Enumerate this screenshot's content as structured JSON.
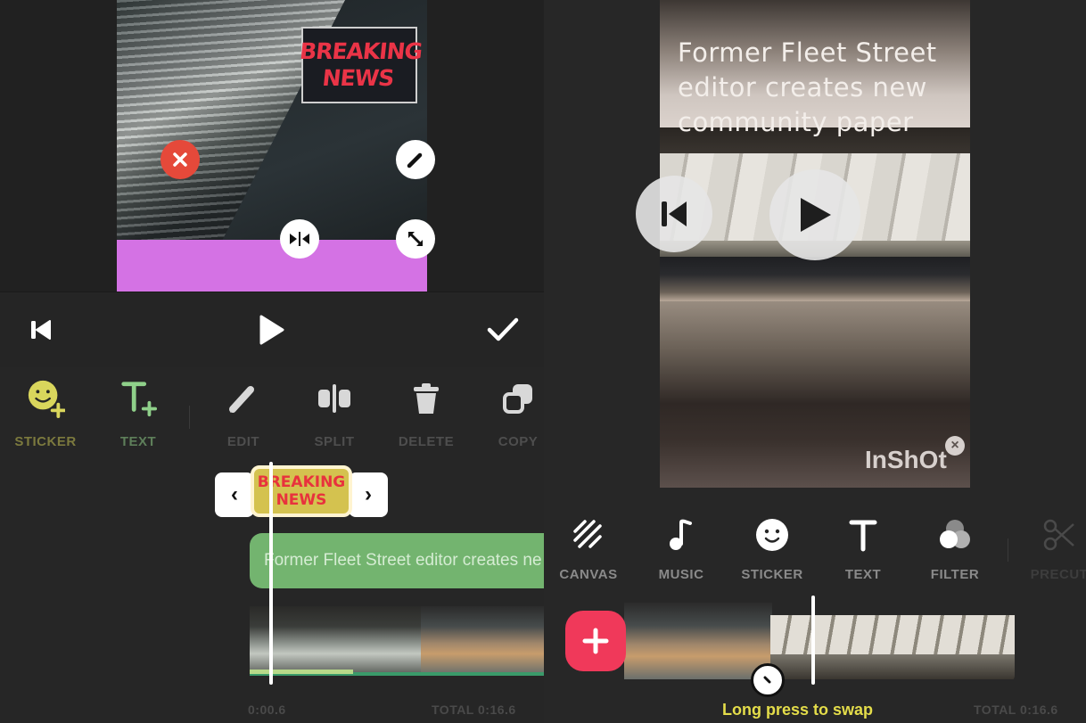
{
  "left_editor": {
    "sticker_overlay": {
      "line1": "BREAKING",
      "line2": "NEWS",
      "handles": [
        "delete-handle",
        "edit-handle",
        "flip-handle",
        "resize-handle"
      ]
    },
    "controls": {
      "rewind_icon": "skip-to-start-icon",
      "play_icon": "play-icon",
      "confirm_icon": "checkmark-icon"
    },
    "toolbar": [
      {
        "id": "sticker",
        "label": "STICKER",
        "icon": "sticker-add-icon",
        "color": "#d9d65c",
        "label_color": "#7c7a3e"
      },
      {
        "id": "text",
        "label": "TEXT",
        "icon": "text-add-icon",
        "color": "#8fd08a",
        "label_color": "#5e7f5a"
      },
      {
        "id": "edit",
        "label": "EDIT",
        "icon": "pencil-icon",
        "color": "#d8d8d8",
        "label_color": "#4e4e4e"
      },
      {
        "id": "split",
        "label": "SPLIT",
        "icon": "split-icon",
        "color": "#d8d8d8",
        "label_color": "#4e4e4e"
      },
      {
        "id": "delete",
        "label": "DELETE",
        "icon": "trash-icon",
        "color": "#d8d8d8",
        "label_color": "#4e4e4e"
      },
      {
        "id": "copy",
        "label": "COPY",
        "icon": "copy-icon",
        "color": "#d8d8d8",
        "label_color": "#4e4e4e"
      }
    ],
    "timeline": {
      "sticker_clip": {
        "line1": "BREAKING",
        "line2": "NEWS",
        "trim_left": "‹",
        "trim_right": "›"
      },
      "text_clip": "Former Fleet Street editor creates ne",
      "current_time": "0:00.6",
      "total_time": "TOTAL 0:16.6"
    }
  },
  "right_editor": {
    "preview_text": "Former Fleet Street editor creates new community paper",
    "watermark": "InShOt",
    "watermark_close": "×",
    "toolbar": [
      {
        "id": "canvas",
        "label": "CANVAS",
        "icon": "canvas-icon"
      },
      {
        "id": "music",
        "label": "MUSIC",
        "icon": "music-note-icon"
      },
      {
        "id": "sticker",
        "label": "STICKER",
        "icon": "smiley-icon"
      },
      {
        "id": "text",
        "label": "TEXT",
        "icon": "text-icon"
      },
      {
        "id": "filter",
        "label": "FILTER",
        "icon": "filter-icon"
      },
      {
        "id": "precut",
        "label": "PRECUT",
        "icon": "scissors-icon",
        "disabled": true
      }
    ],
    "timeline": {
      "add_clip_icon": "plus-icon",
      "hint": "Long press to swap",
      "total_time": "TOTAL 0:16.6"
    },
    "colors": {
      "accent_add": "#f0395a",
      "hint_text": "#e4dd4a"
    }
  }
}
